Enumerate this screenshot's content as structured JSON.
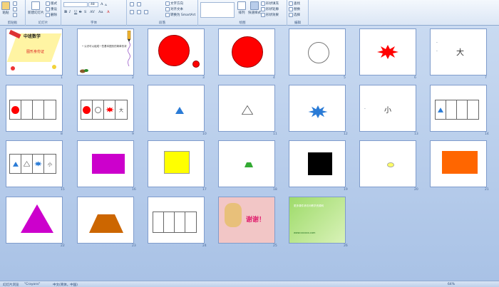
{
  "ribbon": {
    "clipboard": {
      "label": "剪贴板",
      "paste": "粘贴",
      "cut": "剪切",
      "copy": "复制",
      "format": "格式刷"
    },
    "slides": {
      "label": "幻灯片",
      "new_slide": "新建幻灯片",
      "layout": "版式",
      "reset": "重设",
      "delete": "删除"
    },
    "font": {
      "label": "字体",
      "font_name": "",
      "font_size": "48",
      "bold": "B",
      "italic": "I",
      "underline": "U",
      "strike": "S",
      "shadow": "S",
      "spacing": "AV",
      "case": "Aa",
      "color": "A"
    },
    "paragraph": {
      "label": "段落",
      "text_direction": "文字方向",
      "align_text": "对齐文本",
      "smartart": "转换为 SmartArt"
    },
    "drawing": {
      "label": "绘图",
      "arrange": "排列",
      "quick_styles": "快速样式",
      "shape_fill": "形状填充",
      "shape_outline": "形状轮廓",
      "shape_effects": "形状效果"
    },
    "editing": {
      "label": "编辑",
      "find": "查找",
      "replace": "替换",
      "select": "选择"
    }
  },
  "slides": [
    {
      "n": "1",
      "title": "中班数学",
      "subtitle": "图形身份证"
    },
    {
      "n": "2",
      "text": "• 认识可以组成一些基本图形的简单形状"
    },
    {
      "n": "3"
    },
    {
      "n": "4"
    },
    {
      "n": "5"
    },
    {
      "n": "6"
    },
    {
      "n": "7",
      "dot_a": "·",
      "dot_b": "·",
      "char": "大"
    },
    {
      "n": "8"
    },
    {
      "n": "9",
      "char": "大"
    },
    {
      "n": "10"
    },
    {
      "n": "11"
    },
    {
      "n": "12"
    },
    {
      "n": "13",
      "dot": "·",
      "char": "小"
    },
    {
      "n": "14"
    },
    {
      "n": "15",
      "char": "小"
    },
    {
      "n": "16"
    },
    {
      "n": "17"
    },
    {
      "n": "18"
    },
    {
      "n": "19"
    },
    {
      "n": "20"
    },
    {
      "n": "21"
    },
    {
      "n": "22"
    },
    {
      "n": "23"
    },
    {
      "n": "24"
    },
    {
      "n": "25",
      "thanks": "谢谢！"
    },
    {
      "n": "26",
      "line1": "更多课件请访问教学资源网",
      "line2": "www.xxxxxx.com"
    }
  ],
  "status": {
    "view": "幻灯片浏览",
    "theme": "\"Crayons\"",
    "lang": "中文(简体，中国)",
    "zoom": "64%"
  },
  "colors": {
    "red": "#ff0000",
    "magenta": "#cc00cc",
    "yellow": "#ffff00",
    "blue": "#2a7bd6",
    "orange": "#ff6600",
    "brown": "#cc6600",
    "green": "#33aa33"
  }
}
